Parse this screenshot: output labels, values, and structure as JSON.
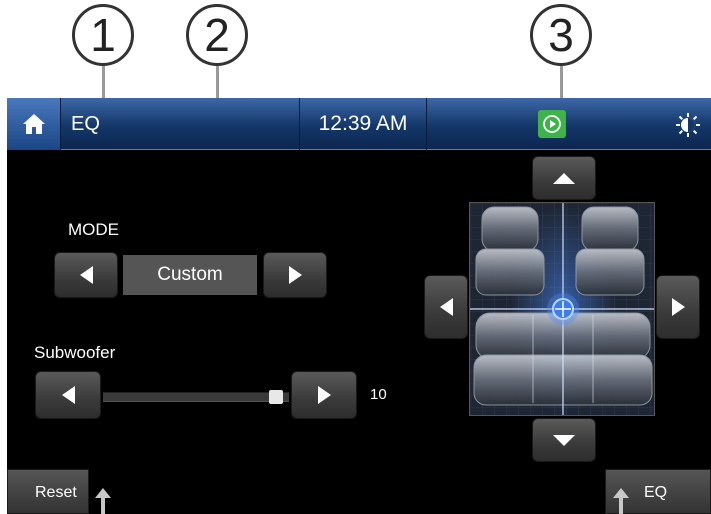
{
  "callouts": [
    "1",
    "2",
    "3"
  ],
  "header": {
    "title": "EQ",
    "time": "12:39 AM",
    "icons": [
      "home-icon",
      "play-icon",
      "brightness-icon"
    ]
  },
  "mode": {
    "label": "MODE",
    "value": "Custom"
  },
  "subwoofer": {
    "label": "Subwoofer",
    "value": "10",
    "level_fraction": 1.0
  },
  "footer": {
    "reset_label": "Reset",
    "eq_label": "EQ"
  },
  "colors": {
    "header_blue": "#143769",
    "play_green": "#3db34a",
    "focus_blue": "#4a8cff"
  }
}
